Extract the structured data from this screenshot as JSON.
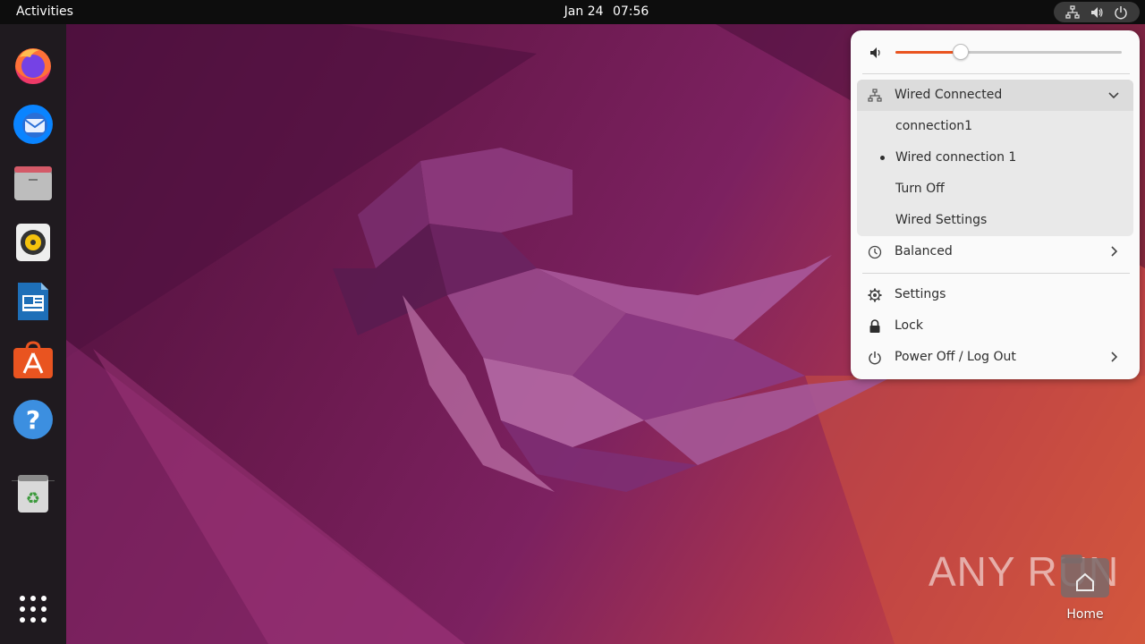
{
  "topbar": {
    "activities": "Activities",
    "date": "Jan 24",
    "time": "07:56",
    "tray_icons": [
      "network-wired-icon",
      "volume-icon",
      "power-icon"
    ]
  },
  "dock": {
    "apps": [
      {
        "name": "Firefox",
        "icon": "firefox-icon"
      },
      {
        "name": "Thunderbird",
        "icon": "thunderbird-icon"
      },
      {
        "name": "Files",
        "icon": "files-icon"
      },
      {
        "name": "Rhythmbox",
        "icon": "rhythmbox-icon"
      },
      {
        "name": "LibreOffice Writer",
        "icon": "writer-icon"
      },
      {
        "name": "Ubuntu Software",
        "icon": "software-icon"
      },
      {
        "name": "Help",
        "icon": "help-icon"
      },
      {
        "name": "Trash",
        "icon": "trash-icon"
      },
      {
        "name": "Show Applications",
        "icon": "app-grid-icon"
      }
    ]
  },
  "menu": {
    "volume": {
      "level": 0.29,
      "icon": "volume-icon"
    },
    "network": {
      "label": "Wired Connected",
      "icon": "network-wired-icon",
      "items": [
        {
          "label": "connection1",
          "active": false
        },
        {
          "label": "Wired connection 1",
          "active": true
        },
        {
          "label": "Turn Off",
          "active": false
        },
        {
          "label": "Wired Settings",
          "active": false
        }
      ]
    },
    "power_mode": {
      "label": "Balanced",
      "icon": "power-profile-icon"
    },
    "settings": {
      "label": "Settings",
      "icon": "gear-icon"
    },
    "lock": {
      "label": "Lock",
      "icon": "lock-icon"
    },
    "power_off": {
      "label": "Power Off / Log Out",
      "icon": "power-icon"
    }
  },
  "desktop": {
    "watermark": "ANY RUN",
    "home_label": "Home"
  },
  "colors": {
    "accent": "#e95420",
    "topbar": "#0d0d0d",
    "dock": "#1f1a1f",
    "menu_bg": "#fafafa"
  }
}
